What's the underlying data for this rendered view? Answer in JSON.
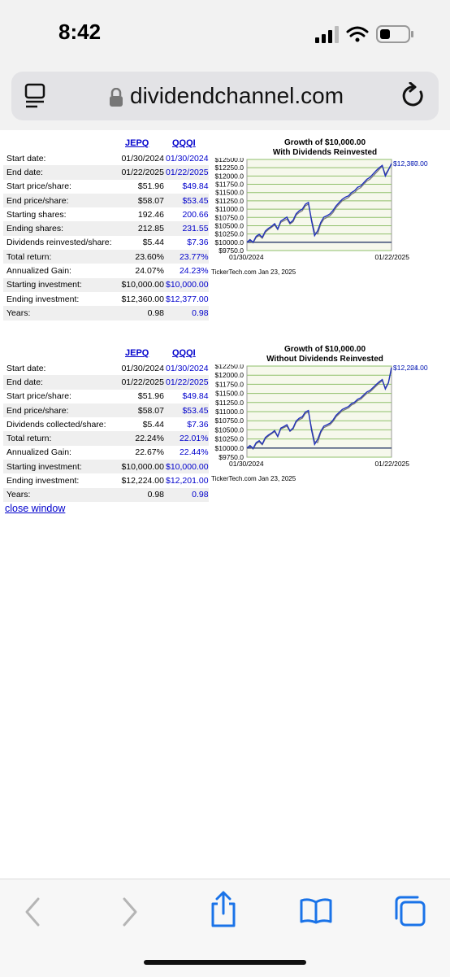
{
  "status_bar": {
    "time": "8:42"
  },
  "browser": {
    "url": "dividendchannel.com"
  },
  "tables": [
    {
      "col1_header": "JEPQ",
      "col2_header": "QQQI",
      "rows": [
        {
          "label": "Start date:",
          "v1": "01/30/2024",
          "v2": "01/30/2024"
        },
        {
          "label": "End date:",
          "v1": "01/22/2025",
          "v2": "01/22/2025"
        },
        {
          "label": "Start price/share:",
          "v1": "$51.96",
          "v2": "$49.84"
        },
        {
          "label": "End price/share:",
          "v1": "$58.07",
          "v2": "$53.45"
        },
        {
          "label": "Starting shares:",
          "v1": "192.46",
          "v2": "200.66"
        },
        {
          "label": "Ending shares:",
          "v1": "212.85",
          "v2": "231.55"
        },
        {
          "label": "Dividends reinvested/share:",
          "v1": "$5.44",
          "v2": "$7.36"
        },
        {
          "label": "Total return:",
          "v1": "23.60%",
          "v2": "23.77%"
        },
        {
          "label": "Annualized Gain:",
          "v1": "24.07%",
          "v2": "24.23%"
        },
        {
          "label": "Starting investment:",
          "v1": "$10,000.00",
          "v2": "$10,000.00"
        },
        {
          "label": "Ending investment:",
          "v1": "$12,360.00",
          "v2": "$12,377.00"
        },
        {
          "label": "Years:",
          "v1": "0.98",
          "v2": "0.98"
        }
      ]
    },
    {
      "col1_header": "JEPQ",
      "col2_header": "QQQI",
      "rows": [
        {
          "label": "Start date:",
          "v1": "01/30/2024",
          "v2": "01/30/2024"
        },
        {
          "label": "End date:",
          "v1": "01/22/2025",
          "v2": "01/22/2025"
        },
        {
          "label": "Start price/share:",
          "v1": "$51.96",
          "v2": "$49.84"
        },
        {
          "label": "End price/share:",
          "v1": "$58.07",
          "v2": "$53.45"
        },
        {
          "label": "Dividends collected/share:",
          "v1": "$5.44",
          "v2": "$7.36"
        },
        {
          "label": "Total return:",
          "v1": "22.24%",
          "v2": "22.01%"
        },
        {
          "label": "Annualized Gain:",
          "v1": "22.67%",
          "v2": "22.44%"
        },
        {
          "label": "Starting investment:",
          "v1": "$10,000.00",
          "v2": "$10,000.00"
        },
        {
          "label": "Ending investment:",
          "v1": "$12,224.00",
          "v2": "$12,201.00"
        },
        {
          "label": "Years:",
          "v1": "0.98",
          "v2": "0.98"
        }
      ]
    }
  ],
  "chart_data": [
    {
      "type": "line",
      "title": "Growth of $10,000.00",
      "subtitle": "With Dividends Reinvested",
      "ylim": [
        9750,
        12500
      ],
      "y_ticks": [
        "$12500.0",
        "$12250.0",
        "$12000.0",
        "$11750.0",
        "$11500.0",
        "$11250.0",
        "$11000.0",
        "$10750.0",
        "$10500.0",
        "$10250.0",
        "$10000.0",
        "$9750.0"
      ],
      "x_start_label": "01/30/2024",
      "x_end_label": "01/22/2025",
      "end_label_1": "$12,360.00",
      "end_label_2": "$12,377.00",
      "grid": true,
      "credit": "TickerTech.com  Jan 23, 2025",
      "series": [
        {
          "color": "#777777",
          "values": [
            10000,
            10050,
            9980,
            10150,
            10200,
            10120,
            10300,
            10380,
            10450,
            10520,
            10380,
            10600,
            10650,
            10700,
            10550,
            10620,
            10820,
            10900,
            10950,
            11100,
            11150,
            10700,
            10300,
            10250,
            10550,
            10700,
            10750,
            10800,
            10900,
            11050,
            11150,
            11250,
            11300,
            11350,
            11450,
            11500,
            11600,
            11650,
            11750,
            11850,
            11900,
            12000,
            12100,
            12200,
            12300,
            12050,
            12200,
            12360
          ]
        },
        {
          "color": "#2233bb",
          "values": [
            10000,
            10080,
            10000,
            10180,
            10240,
            10150,
            10340,
            10420,
            10480,
            10560,
            10400,
            10640,
            10700,
            10760,
            10580,
            10660,
            10860,
            10950,
            11000,
            11150,
            11200,
            10650,
            10200,
            10350,
            10600,
            10760,
            10800,
            10860,
            10960,
            11100,
            11200,
            11300,
            11360,
            11400,
            11500,
            11560,
            11660,
            11700,
            11800,
            11900,
            11960,
            12060,
            12160,
            12250,
            12320,
            12000,
            12180,
            12377
          ]
        }
      ]
    },
    {
      "type": "line",
      "title": "Growth of $10,000.00",
      "subtitle": "Without Dividends Reinvested",
      "ylim": [
        9750,
        12250
      ],
      "y_ticks": [
        "$12250.0",
        "$12000.0",
        "$11750.0",
        "$11500.0",
        "$11250.0",
        "$11000.0",
        "$10750.0",
        "$10500.0",
        "$10250.0",
        "$10000.0",
        "$9750.0"
      ],
      "x_start_label": "01/30/2024",
      "x_end_label": "01/22/2025",
      "end_label_1": "$12,224.00",
      "end_label_2": "$12,201.00",
      "grid": true,
      "credit": "TickerTech.com  Jan 23, 2025",
      "series": [
        {
          "color": "#777777",
          "values": [
            10000,
            10040,
            9970,
            10120,
            10170,
            10090,
            10260,
            10330,
            10390,
            10450,
            10310,
            10520,
            10560,
            10600,
            10460,
            10520,
            10710,
            10780,
            10820,
            10950,
            10990,
            10560,
            10180,
            10150,
            10420,
            10560,
            10600,
            10640,
            10730,
            10860,
            10940,
            11020,
            11060,
            11100,
            11180,
            11220,
            11300,
            11340,
            11420,
            11500,
            11540,
            11620,
            11700,
            11780,
            11850,
            11650,
            11800,
            12224
          ]
        },
        {
          "color": "#2233bb",
          "values": [
            10000,
            10070,
            9990,
            10150,
            10200,
            10110,
            10290,
            10360,
            10410,
            10480,
            10320,
            10550,
            10590,
            10640,
            10470,
            10550,
            10740,
            10820,
            10860,
            10990,
            11030,
            10500,
            10100,
            10240,
            10460,
            10600,
            10640,
            10680,
            10770,
            10900,
            10980,
            11060,
            11100,
            11140,
            11220,
            11260,
            11340,
            11380,
            11460,
            11540,
            11580,
            11660,
            11740,
            11820,
            11880,
            11620,
            11790,
            12201
          ]
        }
      ]
    }
  ],
  "close_link": "close window"
}
